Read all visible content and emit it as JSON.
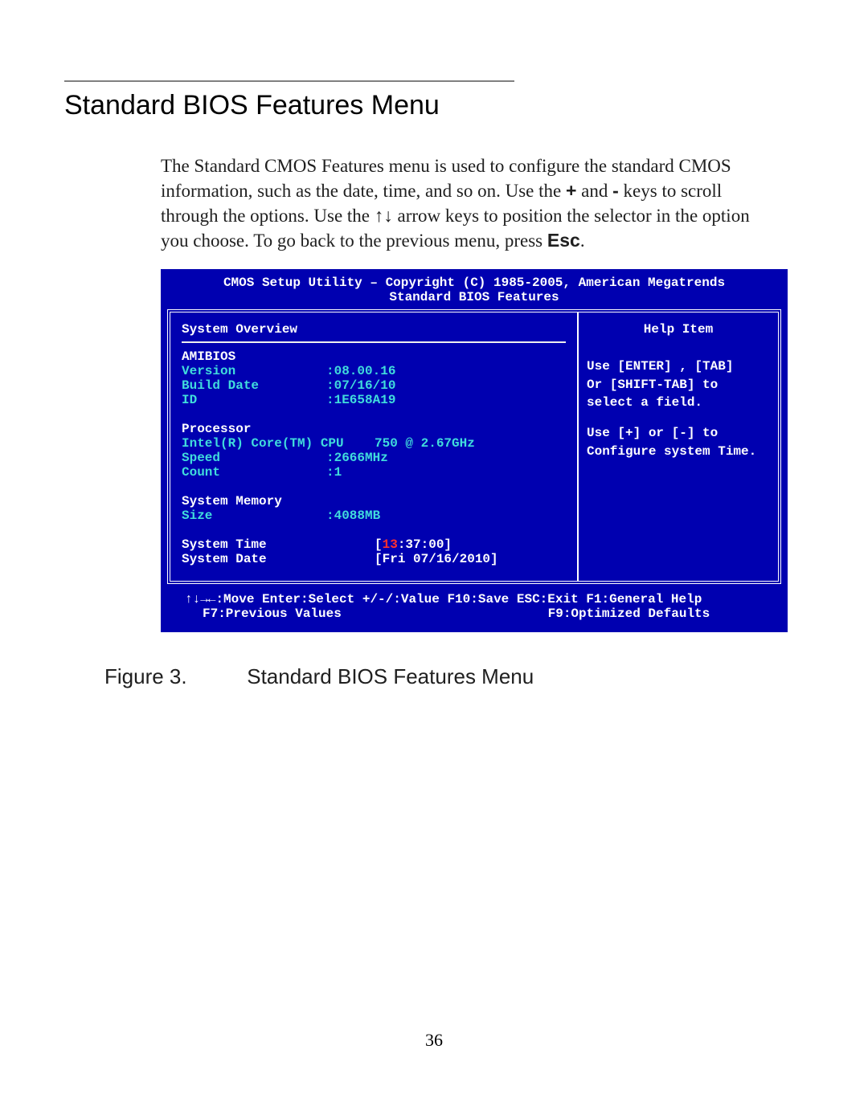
{
  "section": {
    "title": "Standard BIOS Features Menu"
  },
  "paragraph": {
    "p1a": "The Standard CMOS Features menu is used to configure the standard CMOS information, such as the date, time, and so on. Use the ",
    "plus": "+",
    "p1b": " and ",
    "minus": "-",
    "p1c": " keys to scroll through the options. Use the ",
    "arrows": "↑↓",
    "p1d": " arrow keys to position the selector in the option you choose. To go back to the previous menu, press ",
    "esc": "Esc",
    "p1e": "."
  },
  "bios": {
    "header_line1": "CMOS Setup Utility – Copyright (C) 1985-2005, American Megatrends",
    "header_line2": "Standard BIOS Features",
    "left": {
      "overview": "System Overview",
      "amibios": "AMIBIOS",
      "version_label": "Version",
      "version_value": ":08.00.16",
      "build_label": "Build Date",
      "build_value": ":07/16/10",
      "id_label": "ID",
      "id_value": ":1E658A19",
      "processor": "Processor",
      "cpu_label": "Intel(R) Core(TM) CPU",
      "cpu_value": "750  @ 2.67GHz",
      "speed_label": "Speed",
      "speed_value": ":2666MHz",
      "count_label": "Count",
      "count_value": ":1",
      "memory": "System Memory",
      "size_label": "Size",
      "size_value": ":4088MB",
      "time_label": "System Time",
      "time_hh": "13",
      "time_rest": ":37:00",
      "date_label": "System Date",
      "date_value": "Fri 07/16/2010"
    },
    "help": {
      "title": "Help Item",
      "l1": "Use [ENTER] , [TAB]",
      "l2": "Or [SHIFT-TAB] to",
      "l3": "select a field.",
      "l4": "Use [+] or [-] to",
      "l5": "Configure system Time."
    },
    "footer": {
      "line1": "↑↓→←:Move  Enter:Select  +/-/:Value  F10:Save  ESC:Exit  F1:General Help",
      "line2_left": "F7:Previous Values",
      "line2_right": "F9:Optimized Defaults"
    }
  },
  "figure": {
    "num": "Figure 3.",
    "title": "Standard BIOS Features Menu"
  },
  "page_number": "36"
}
